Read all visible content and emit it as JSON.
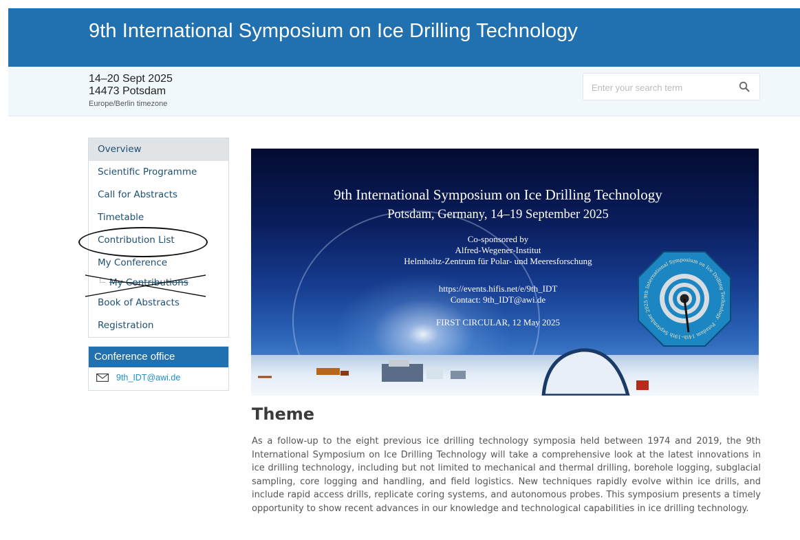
{
  "header": {
    "title": "9th International Symposium on Ice Drilling Technology",
    "date": "14–20 Sept 2025",
    "location": "14473 Potsdam",
    "timezone": "Europe/Berlin timezone"
  },
  "search": {
    "placeholder": "Enter your search term",
    "icon": "search-icon"
  },
  "menu": {
    "items": [
      {
        "label": "Overview",
        "active": true
      },
      {
        "label": "Scientific Programme"
      },
      {
        "label": "Call for Abstracts"
      },
      {
        "label": "Timetable"
      },
      {
        "label": "Contribution List",
        "annotation": "circled"
      },
      {
        "label": "My Conference"
      },
      {
        "label": "My Contributions",
        "annotation": "crossed-out"
      },
      {
        "label": "Book of Abstracts"
      },
      {
        "label": "Registration"
      }
    ]
  },
  "office": {
    "title": "Conference office",
    "email": "9th_IDT@awi.de",
    "icon": "mail-icon"
  },
  "banner": {
    "title": "9th International Symposium on Ice Drilling Technology",
    "subtitle": "Potsdam, Germany, 14–19 September 2025",
    "cosponsored_line1": "Co-sponsored by",
    "cosponsored_line2": "Alfred-Wegener-Institut",
    "cosponsored_line3": "Helmholtz-Zentrum für Polar- und Meeresforschung",
    "url": "https://events.hifis.net/e/9th_IDT",
    "contact": "Contact: 9th_IDT@awi.de",
    "circular": "FIRST CIRCULAR, 12 May 2025",
    "logo_text": "9th International Symposium on Ice Drilling Technology · Potsdam 14th–19th September 2025"
  },
  "theme": {
    "heading": "Theme",
    "body": "As a follow-up to the eight previous ice drilling technology symposia held between 1974 and 2019, the 9th International Symposium on Ice Drilling Technology will take a comprehensive look at the latest innovations in ice drilling technology, including but not limited to mechanical and thermal drilling, borehole logging, subglacial sampling, core logging and handling, and field logistics. New techniques rapidly evolve within ice drills, and include rapid access drills, replicate coring systems, and autonomous probes. This symposium presents a timely opportunity to show recent advances in our knowledge and technological capabilities in ice drilling technology."
  },
  "colors": {
    "brand": "#2171b0",
    "link": "#1b8fc7",
    "menu_text": "#1d4f73",
    "info_bg": "#f0f8fc"
  }
}
